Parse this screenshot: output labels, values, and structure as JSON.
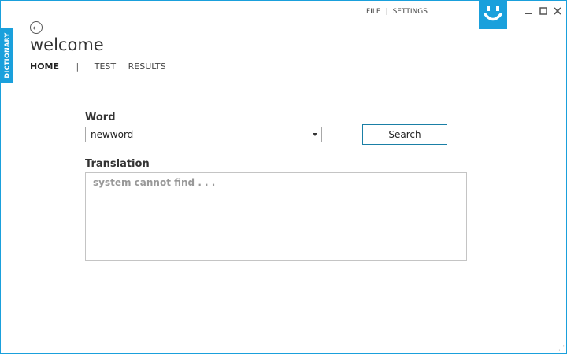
{
  "app": {
    "side_tab_label": "DICTIONARY",
    "page_title": "welcome",
    "top_menu": [
      "FILE",
      "SETTINGS"
    ],
    "accent_color": "#1aa0dc"
  },
  "nav": {
    "home": "HOME",
    "separator": "|",
    "test": "TEST",
    "results": "RESULTS"
  },
  "form": {
    "word_label": "Word",
    "word_value": "newword",
    "search_label": "Search",
    "translation_label": "Translation",
    "translation_text": "system cannot find . . ."
  },
  "icons": {
    "back": "back-arrow-icon",
    "logo": "smiley-logo-icon",
    "minimize": "minimize-icon",
    "maximize": "maximize-icon",
    "close": "close-icon"
  }
}
